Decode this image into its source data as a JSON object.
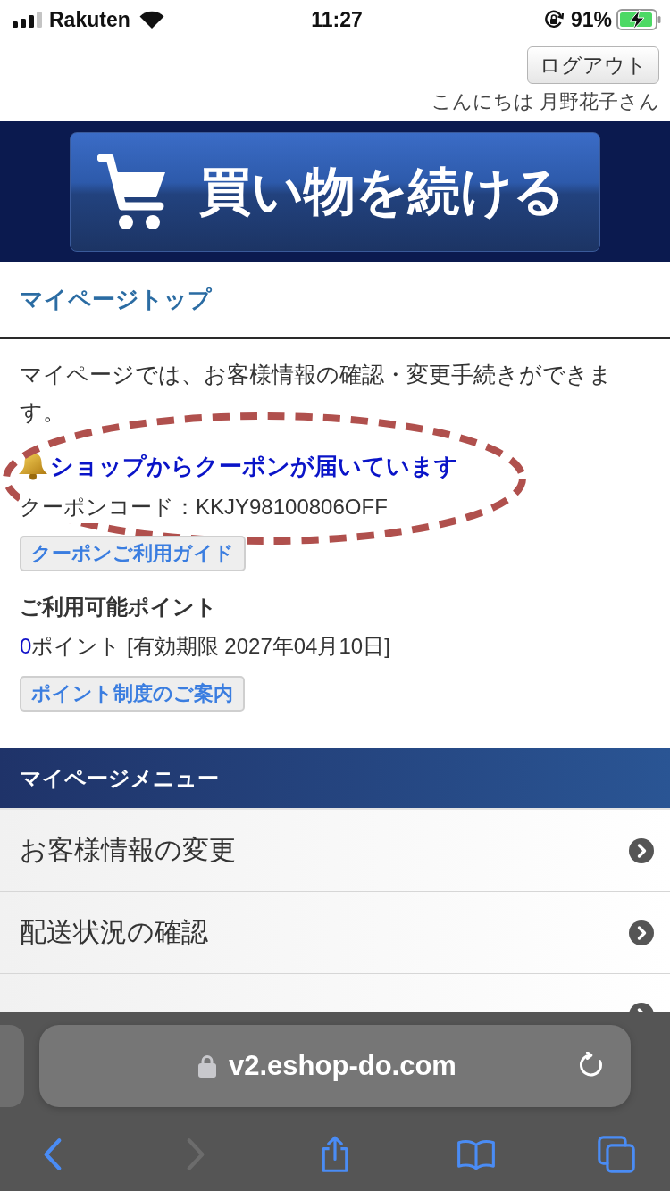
{
  "status_bar": {
    "carrier": "Rakuten",
    "time": "11:27",
    "battery": "91%"
  },
  "header": {
    "logout_button": "ログアウト",
    "greeting": "こんにちは 月野花子さん"
  },
  "banner": {
    "button_label": "買い物を続ける"
  },
  "page_title": "マイページトップ",
  "intro": "マイページでは、お客様情報の確認・変更手続きができます。",
  "coupon": {
    "notice": "ショップからクーポンが届いています",
    "code_line": "クーポンコード：KKJY98100806OFF",
    "guide_button": "クーポンご利用ガイド"
  },
  "points": {
    "heading": "ご利用可能ポイント",
    "value": "0",
    "detail": "ポイント [有効期限 2027年04月10日]",
    "guide_button": "ポイント制度のご案内"
  },
  "menu": {
    "title": "マイページメニュー",
    "items": [
      {
        "kind": "link",
        "label": "お客様情報の変更"
      },
      {
        "kind": "link",
        "label": "配送状況の確認"
      },
      {
        "kind": "cut"
      }
    ]
  },
  "browser": {
    "url": "v2.eshop-do.com",
    "toolbar": [
      {
        "kind": "back",
        "disabled": false
      },
      {
        "kind": "forward",
        "disabled": true
      },
      {
        "kind": "share",
        "disabled": false
      },
      {
        "kind": "bookmarks",
        "disabled": false
      },
      {
        "kind": "tabs",
        "disabled": false
      }
    ]
  }
}
